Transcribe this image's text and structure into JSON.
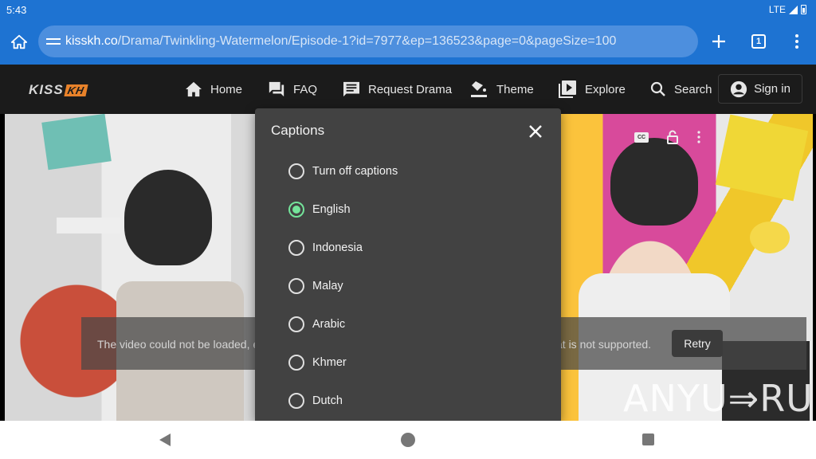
{
  "status_bar": {
    "time": "5:43",
    "network": "LTE"
  },
  "browser": {
    "url_host": "kisskh.co",
    "url_path": "/Drama/Twinkling-Watermelon/Episode-1?id=7977&ep=136523&page=0&pageSize=100",
    "tab_count": "1",
    "icons": [
      "home-icon",
      "site-settings-icon",
      "new-tab-icon",
      "tab-switcher-icon",
      "overflow-menu-icon"
    ]
  },
  "site": {
    "logo_main": "KISS",
    "logo_badge": "KH",
    "nav": [
      "Home",
      "FAQ",
      "Request Drama",
      "Theme",
      "Explore",
      "Search"
    ],
    "signin_label": "Sign in",
    "accent": "#e8822a"
  },
  "player": {
    "error_text_left": "The video could not be loaded, ei",
    "error_text_right": "at is not supported.",
    "retry_label": "Retry",
    "watermark": "ANYU⇒RUN",
    "cc_label": "CC"
  },
  "captions_dialog": {
    "title": "Captions",
    "options": [
      "Turn off captions",
      "English",
      "Indonesia",
      "Malay",
      "Arabic",
      "Khmer",
      "Dutch"
    ],
    "selected": "English",
    "selected_color": "#74e39a"
  }
}
